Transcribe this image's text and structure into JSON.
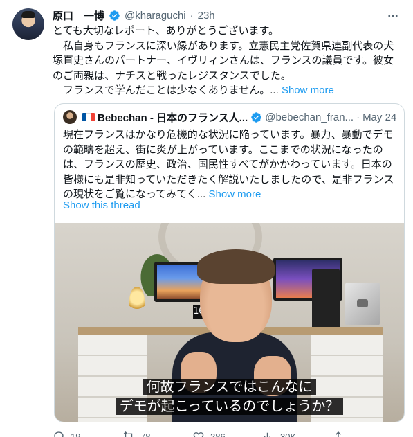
{
  "tweet": {
    "author_name": "原口　一博",
    "handle": "@kharaguchi",
    "separator": "·",
    "time": "23h",
    "paragraphs": [
      "とても大切なレポート、ありがとうございます。",
      "　私自身もフランスに深い縁があります。立憲民主党佐賀県連副代表の犬塚直史さんのパートナー、イヴリィンさんは、フランスの議員です。彼女のご両親は、ナチスと戦ったレジスタンスでした。",
      "　フランスで学んだことは少なくありません。... "
    ],
    "show_more": "Show more"
  },
  "quote": {
    "author_name": "Bebechan - 日本のフランス人...",
    "handle": "@bebechan_fran...",
    "separator": "·",
    "date": "May 24",
    "text": "現在フランスはかなり危機的な状況に陥っています。暴力、暴動でデモの範疇を超え、街に炎が上がっています。ここまでの状況になったのは、フランスの歴史、政治、国民性すべてがかかわっています。日本の皆様にも是非知っていただきたく解説いたしましたので、是非フランスの現状をご覧になってみてく... ",
    "show_more": "Show more",
    "show_thread": "Show this thread",
    "flag_colors": [
      "#0055a4",
      "#ffffff",
      "#ef4135"
    ],
    "media": {
      "clock_text": "16:13",
      "subtitle_line1": "何故フランスではこんなに",
      "subtitle_line2": "デモが起こっているのでしょうか？"
    }
  },
  "actions": {
    "reply_count": "19",
    "retweet_count": "78",
    "like_count": "286",
    "views_count": "30K"
  },
  "colors": {
    "accent": "#1d9bf0",
    "secondary_text": "#536471",
    "border": "#cfd9de"
  }
}
